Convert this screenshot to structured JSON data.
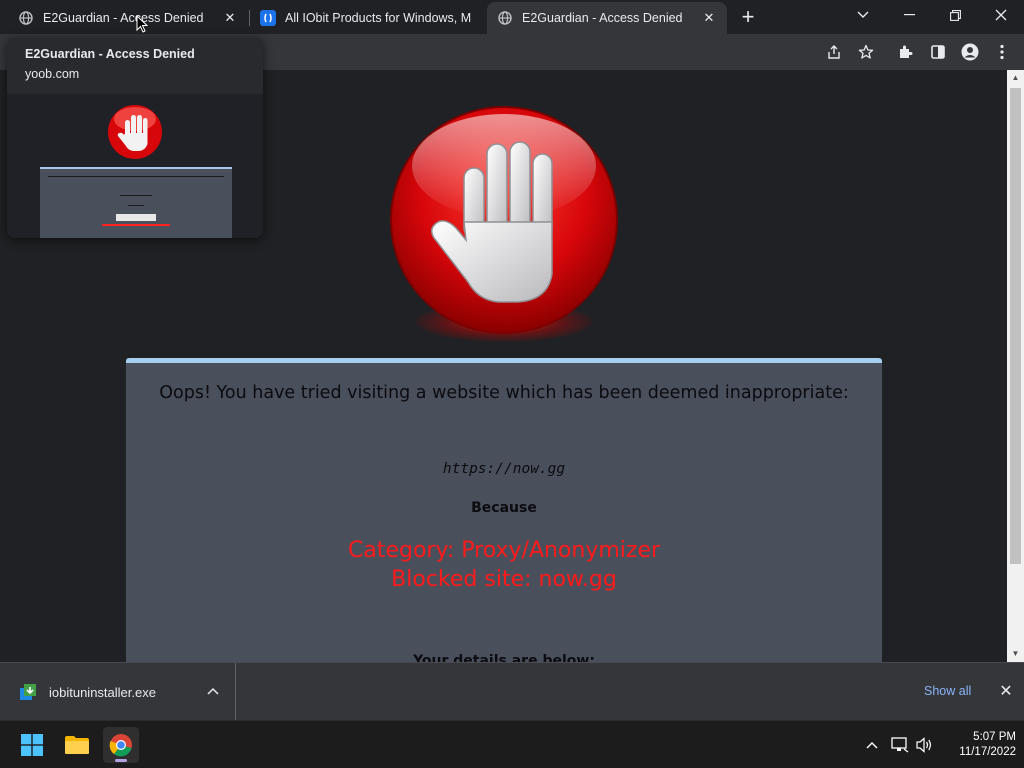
{
  "tabs": [
    {
      "title": "E2Guardian - Access Denied",
      "favicon": "globe-icon",
      "active": true
    },
    {
      "title": "All IObit Products for Windows, M",
      "favicon": "iobit-icon",
      "active": false
    },
    {
      "title": "E2Guardian - Access Denied",
      "favicon": "globe-icon",
      "active": false
    }
  ],
  "hover_card": {
    "title": "E2Guardian - Access Denied",
    "domain": "yoob.com"
  },
  "page": {
    "heading": "Oops! You have tried visiting a website which has been deemed inappropriate:",
    "url": "https://now.gg",
    "because": "Because",
    "reason_category": "Category: Proxy/Anonymizer",
    "reason_site": "Blocked site: now.gg",
    "details": "Your details are below:"
  },
  "download_bar": {
    "file_name": "iobituninstaller.exe",
    "show_all": "Show all"
  },
  "taskbar": {
    "time": "5:07 PM",
    "date": "11/17/2022"
  },
  "colors": {
    "accent_link": "#8ab4f8",
    "reason_red": "#ff1a1a",
    "panel_bg": "#4a4f5c",
    "panel_border": "#a8cff0"
  }
}
